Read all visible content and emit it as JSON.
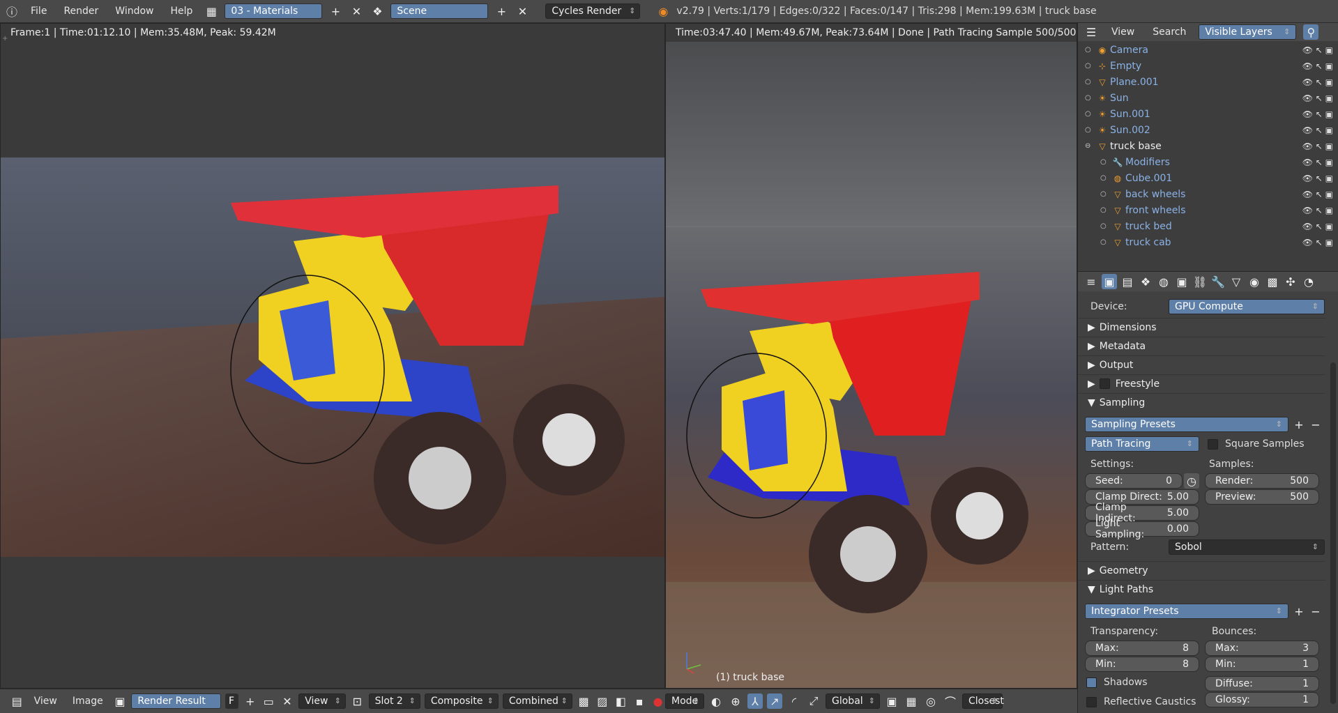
{
  "topbar": {
    "menus": [
      "File",
      "Render",
      "Window",
      "Help"
    ],
    "screen_layout": "03 - Materials",
    "scene": "Scene",
    "render_engine": "Cycles Render",
    "stats": "v2.79 | Verts:1/179 | Edges:0/322 | Faces:0/147 | Tris:298 | Mem:199.63M | truck base"
  },
  "left_view": {
    "header": "Frame:1 | Time:01:12.10 | Mem:35.48M, Peak: 59.42M",
    "bottom": {
      "menus": [
        "View",
        "Image"
      ],
      "image_name": "Render Result",
      "fake_user": "F",
      "view_label": "View",
      "slot": "Slot 2",
      "layer": "Composite",
      "pass": "Combined"
    }
  },
  "right_view": {
    "header": "Time:03:47.40 | Mem:49.67M, Peak:73.64M | Done | Path Tracing Sample 500/500",
    "object_label": "(1) truck base",
    "bottom": {
      "mode": "Mode",
      "orientation": "Global",
      "snap": "Closest"
    }
  },
  "outliner": {
    "header": {
      "menus": [
        "View",
        "Search"
      ],
      "filter": "Visible Layers"
    },
    "items": [
      {
        "name": "Camera",
        "indent": 0,
        "active": false
      },
      {
        "name": "Empty",
        "indent": 0,
        "active": false
      },
      {
        "name": "Plane.001",
        "indent": 0,
        "active": false
      },
      {
        "name": "Sun",
        "indent": 0,
        "active": false
      },
      {
        "name": "Sun.001",
        "indent": 0,
        "active": false
      },
      {
        "name": "Sun.002",
        "indent": 0,
        "active": false
      },
      {
        "name": "truck base",
        "indent": 0,
        "active": true
      },
      {
        "name": "Modifiers",
        "indent": 1,
        "active": false
      },
      {
        "name": "Cube.001",
        "indent": 1,
        "active": false
      },
      {
        "name": "back wheels",
        "indent": 1,
        "active": false
      },
      {
        "name": "front wheels",
        "indent": 1,
        "active": false
      },
      {
        "name": "truck bed",
        "indent": 1,
        "active": false
      },
      {
        "name": "truck cab",
        "indent": 1,
        "active": false
      }
    ]
  },
  "properties": {
    "device_label": "Device:",
    "device": "GPU Compute",
    "panels_collapsed": [
      "Dimensions",
      "Metadata",
      "Output",
      "Freestyle"
    ],
    "sampling": {
      "title": "Sampling",
      "presets": "Sampling Presets",
      "integrator": "Path Tracing",
      "square_samples": "Square Samples",
      "settings_label": "Settings:",
      "samples_label": "Samples:",
      "seed_label": "Seed:",
      "seed": "0",
      "clamp_direct_label": "Clamp Direct:",
      "clamp_direct": "5.00",
      "clamp_indirect_label": "Clamp Indirect:",
      "clamp_indirect": "5.00",
      "light_sampling_label": "Light Sampling:",
      "light_sampling": "0.00",
      "render_label": "Render:",
      "render": "500",
      "preview_label": "Preview:",
      "preview": "500",
      "pattern_label": "Pattern:",
      "pattern": "Sobol"
    },
    "geometry": "Geometry",
    "light_paths": {
      "title": "Light Paths",
      "presets": "Integrator Presets",
      "transparency_label": "Transparency:",
      "bounces_label": "Bounces:",
      "t_max_label": "Max:",
      "t_max": "8",
      "t_min_label": "Min:",
      "t_min": "8",
      "b_max_label": "Max:",
      "b_max": "3",
      "b_min_label": "Min:",
      "b_min": "1",
      "shadows": "Shadows",
      "diffuse_label": "Diffuse:",
      "diffuse": "1",
      "glossy_label": "Glossy:",
      "glossy": "1",
      "reflective_caustics": "Reflective Caustics"
    }
  }
}
